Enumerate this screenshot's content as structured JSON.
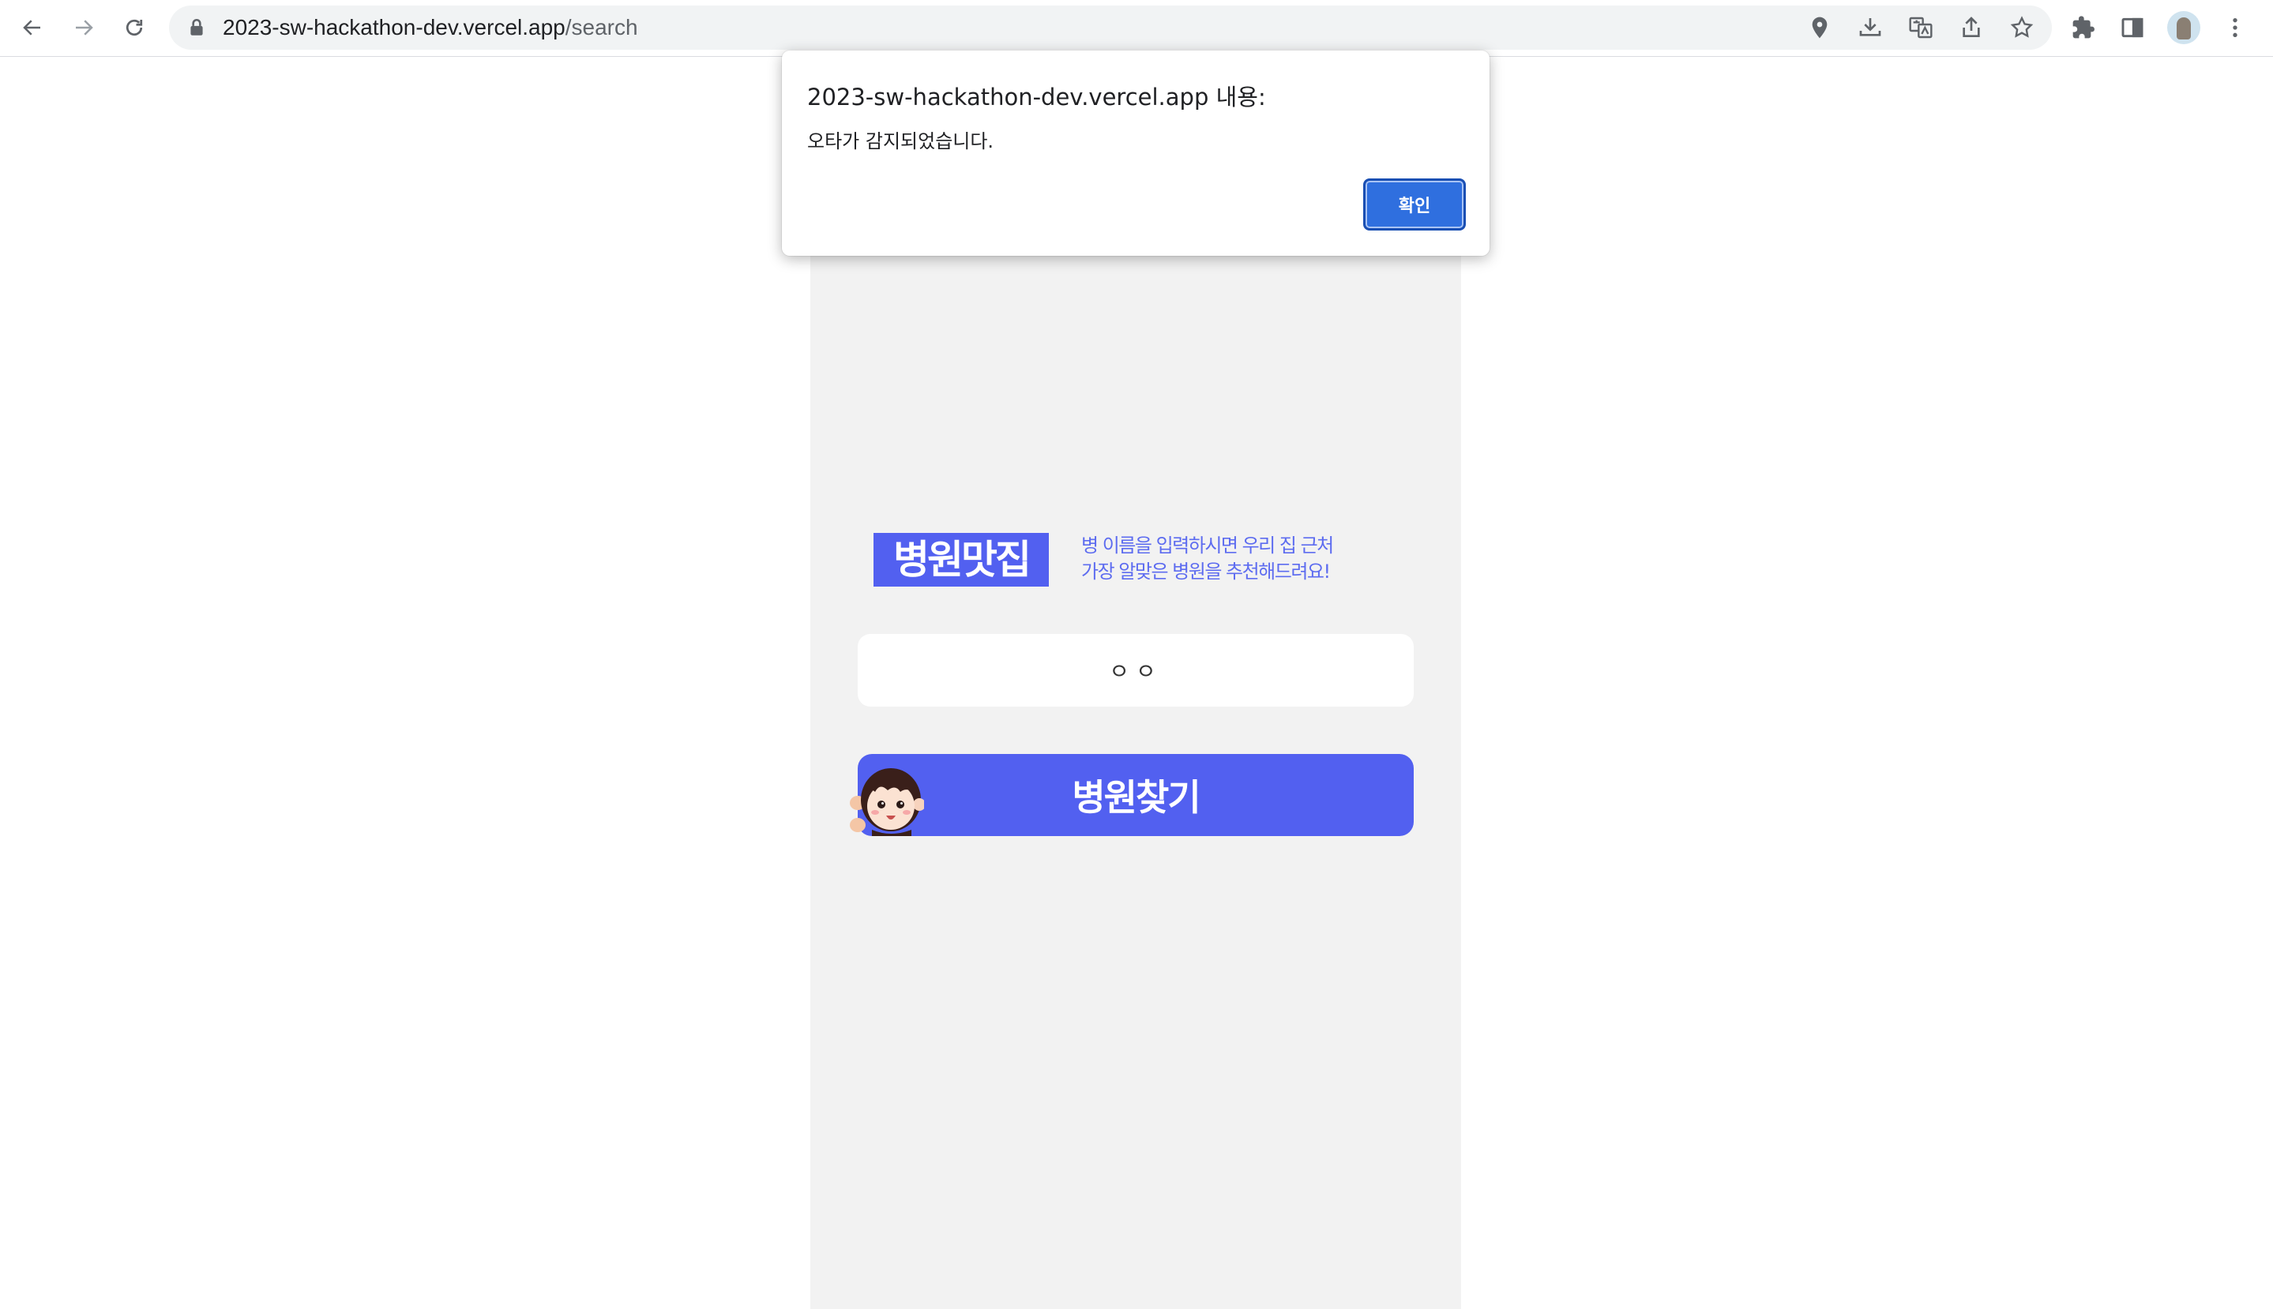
{
  "browser": {
    "url_host": "2023-sw-hackathon-dev.vercel.app",
    "url_path": "/search",
    "omnibox_icons": [
      "location-icon",
      "install-app-icon",
      "translate-icon",
      "share-icon",
      "bookmark-star-icon"
    ],
    "toolbar_icons": [
      "extensions-icon",
      "side-panel-icon",
      "profile-avatar",
      "more-menu-icon"
    ]
  },
  "page": {
    "logo_text": "병원맛집",
    "tagline_line1": "병 이름을 입력하시면 우리 집 근처",
    "tagline_line2": "가장 알맞은 병원을 추천해드려요!",
    "search_value": "ㅇㅇ",
    "find_button_label": "병원찾기"
  },
  "dialog": {
    "title": "2023-sw-hackathon-dev.vercel.app 내용:",
    "message": "오타가 감지되었습니다.",
    "ok_label": "확인"
  },
  "colors": {
    "brand": "#5260f0",
    "page_bg": "#f2f2f2",
    "dialog_button": "#2f6fdf"
  }
}
